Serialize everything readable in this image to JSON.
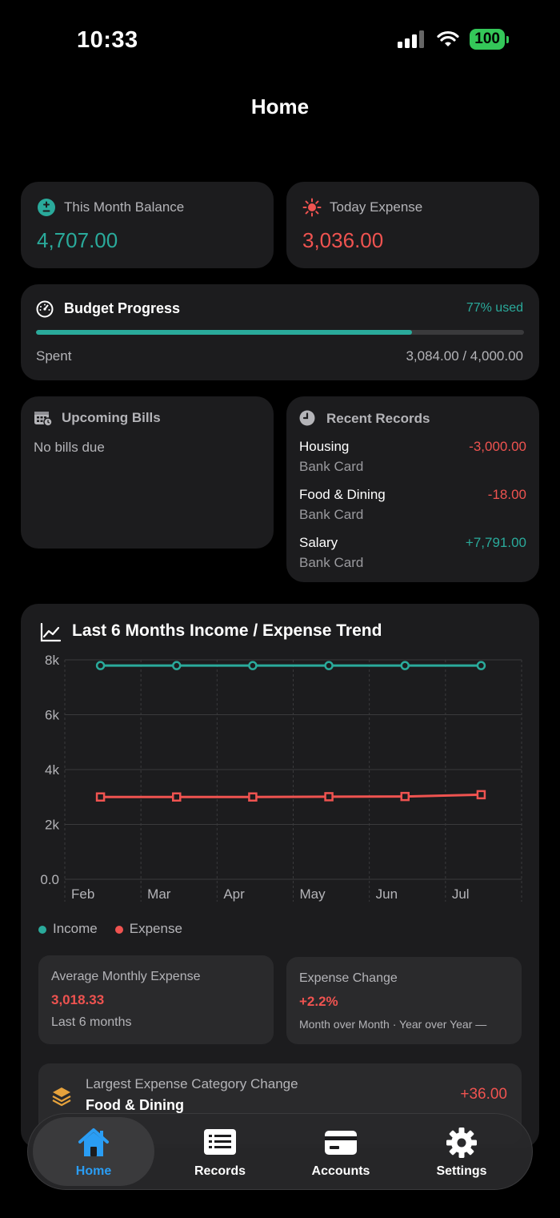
{
  "status": {
    "time": "10:33",
    "battery": "100"
  },
  "header": {
    "title": "Home"
  },
  "balance_card": {
    "label": "This Month Balance",
    "value": "4,707.00",
    "icon": "plus-minus-icon"
  },
  "expense_card": {
    "label": "Today Expense",
    "value": "3,036.00",
    "icon": "sun-icon"
  },
  "budget": {
    "title": "Budget Progress",
    "used_label": "77% used",
    "progress": 0.77,
    "spent_label": "Spent",
    "spent_value": "3,084.00 / 4,000.00"
  },
  "bills": {
    "title": "Upcoming Bills",
    "empty_text": "No bills due"
  },
  "recent": {
    "title": "Recent Records",
    "items": [
      {
        "category": "Housing",
        "account": "Bank Card",
        "amount": "-3,000.00",
        "type": "expense"
      },
      {
        "category": "Food & Dining",
        "account": "Bank Card",
        "amount": "-18.00",
        "type": "expense"
      },
      {
        "category": "Salary",
        "account": "Bank Card",
        "amount": "+7,791.00",
        "type": "income"
      }
    ]
  },
  "trend": {
    "title": "Last 6 Months Income / Expense Trend",
    "legend_income": "Income",
    "legend_expense": "Expense"
  },
  "chart_data": {
    "type": "line",
    "title": "Last 6 Months Income / Expense Trend",
    "categories": [
      "Feb",
      "Mar",
      "Apr",
      "May",
      "Jun",
      "Jul"
    ],
    "y_ticks": [
      "0.0",
      "2k",
      "4k",
      "6k",
      "8k"
    ],
    "ylim": [
      0,
      8000
    ],
    "grid": true,
    "legend": "bottom-left",
    "series": [
      {
        "name": "Income",
        "color": "#2aaa9b",
        "marker": "circle",
        "values": [
          7791,
          7791,
          7791,
          7791,
          7791,
          7791
        ]
      },
      {
        "name": "Expense",
        "color": "#ef5350",
        "marker": "square",
        "values": [
          3000,
          3000,
          3000,
          3010,
          3018,
          3084
        ]
      }
    ]
  },
  "avg_expense": {
    "label": "Average Monthly Expense",
    "value": "3,018.33",
    "footer": "Last 6 months"
  },
  "expense_change": {
    "label": "Expense Change",
    "value": "+2.2%",
    "footer": "Month over Month · Year over Year —"
  },
  "largest_change": {
    "label": "Largest Expense Category Change",
    "category": "Food & Dining",
    "value": "+36.00",
    "icon": "layers-icon"
  },
  "tabs": [
    {
      "label": "Home",
      "icon": "home-icon",
      "active": true
    },
    {
      "label": "Records",
      "icon": "list-icon",
      "active": false
    },
    {
      "label": "Accounts",
      "icon": "card-icon",
      "active": false
    },
    {
      "label": "Settings",
      "icon": "gear-icon",
      "active": false
    }
  ],
  "colors": {
    "accent": "#2aaa9b",
    "expense": "#ef5350",
    "active_tab": "#2a9df4",
    "card": "#1c1c1e"
  }
}
